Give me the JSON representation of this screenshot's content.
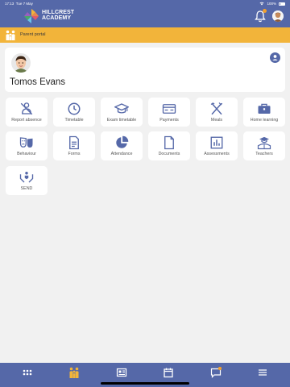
{
  "status_bar": {
    "time": "17:13",
    "date": "Tue 7 May",
    "battery": "100%"
  },
  "school": {
    "line1": "HILLCREST",
    "line2": "ACADEMY"
  },
  "portal": {
    "label": "Parent portal"
  },
  "student": {
    "name": "Tomos Evans"
  },
  "tiles": [
    {
      "label": "Report absence",
      "icon": "person-off-icon"
    },
    {
      "label": "Timetable",
      "icon": "clock-icon"
    },
    {
      "label": "Exam timetable",
      "icon": "graduation-cap-icon"
    },
    {
      "label": "Payments",
      "icon": "payment-card-icon"
    },
    {
      "label": "Meals",
      "icon": "cutlery-icon"
    },
    {
      "label": "Home learning",
      "icon": "briefcase-icon"
    },
    {
      "label": "Behaviour",
      "icon": "mask-icon"
    },
    {
      "label": "Forms",
      "icon": "form-icon"
    },
    {
      "label": "Attendance",
      "icon": "pie-chart-icon"
    },
    {
      "label": "Documents",
      "icon": "document-icon"
    },
    {
      "label": "Assessments",
      "icon": "bar-chart-icon"
    },
    {
      "label": "Teachers",
      "icon": "teacher-icon"
    },
    {
      "label": "SEND",
      "icon": "hands-heart-icon"
    }
  ],
  "bottom_nav": [
    "apps-icon",
    "family-icon",
    "news-icon",
    "calendar-icon",
    "messages-icon",
    "menu-icon"
  ],
  "colors": {
    "primary": "#5568a8",
    "accent": "#f2b43a",
    "notification": "#f0a030",
    "background": "#f1f1f1"
  }
}
